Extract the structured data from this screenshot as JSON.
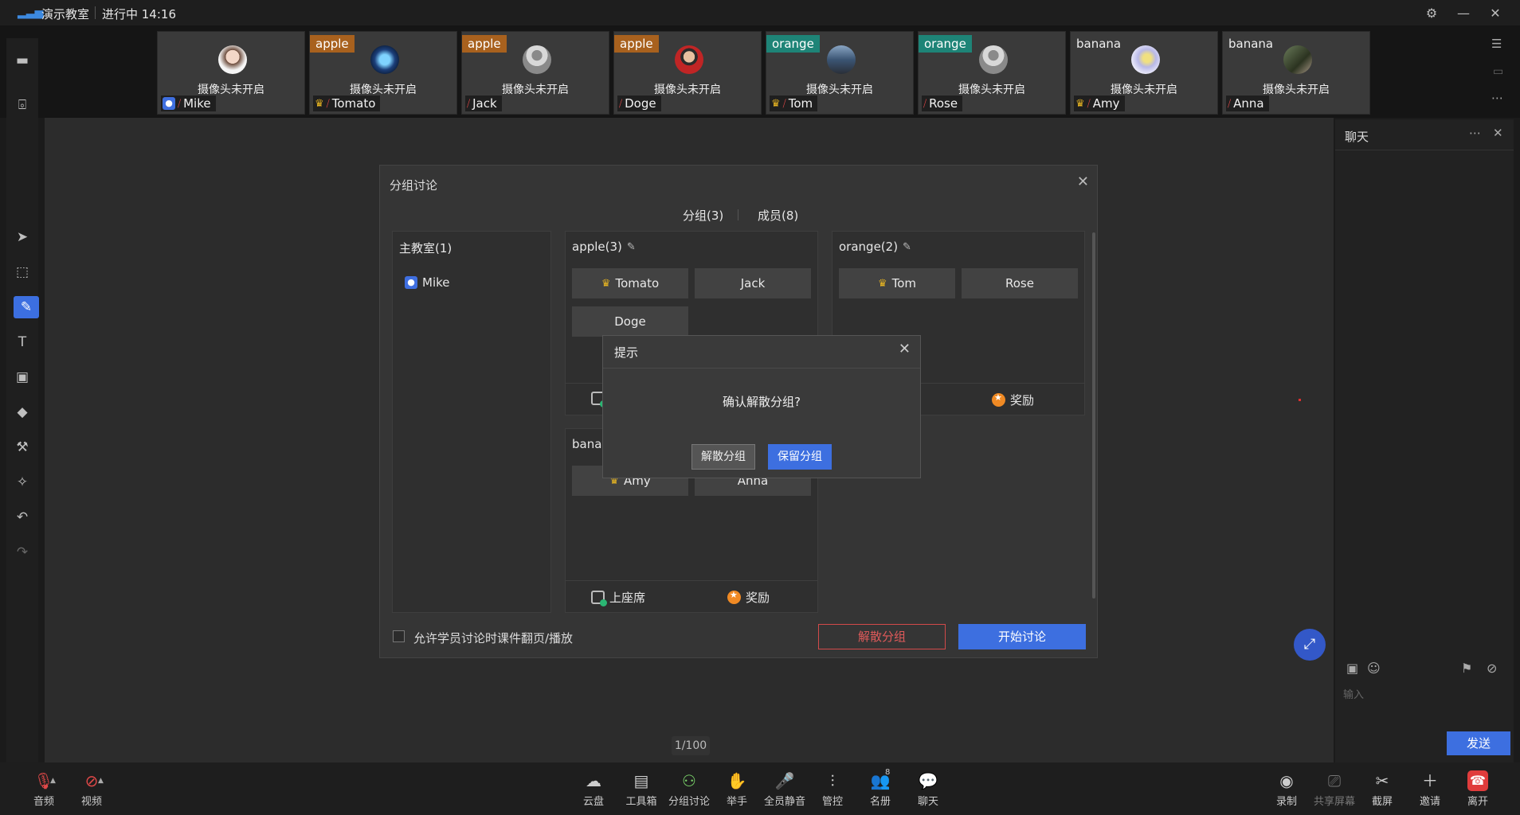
{
  "titlebar": {
    "room": "演示教室",
    "status": "进行中 14:16"
  },
  "tiles": [
    {
      "tag": "",
      "name": "Mike",
      "cam": "摄像头未开启",
      "crown": false,
      "host": true
    },
    {
      "tag": "apple",
      "name": "Tomato",
      "cam": "摄像头未开启",
      "crown": true
    },
    {
      "tag": "apple",
      "name": "Jack",
      "cam": "摄像头未开启",
      "crown": false
    },
    {
      "tag": "apple",
      "name": "Doge",
      "cam": "摄像头未开启",
      "crown": false
    },
    {
      "tag": "orange",
      "name": "Tom",
      "cam": "摄像头未开启",
      "crown": true
    },
    {
      "tag": "orange",
      "name": "Rose",
      "cam": "摄像头未开启",
      "crown": false
    },
    {
      "tag": "banana",
      "name": "Amy",
      "cam": "摄像头未开启",
      "crown": true
    },
    {
      "tag": "banana",
      "name": "Anna",
      "cam": "摄像头未开启",
      "crown": false
    }
  ],
  "dialog": {
    "title": "分组讨论",
    "tab_groups": "分组(3)",
    "tab_members": "成员(8)",
    "main_room": {
      "title": "主教室(1)",
      "member": "Mike"
    },
    "apple": {
      "title": "apple(3)",
      "m1": "Tomato",
      "m2": "Jack",
      "m3": "Doge"
    },
    "orange": {
      "title": "orange(2)",
      "m1": "Tom",
      "m2": "Rose",
      "reward": "奖励"
    },
    "banana": {
      "title": "banar",
      "m1": "Amy",
      "m2": "Anna",
      "seat": "上座席",
      "reward": "奖励"
    },
    "allow_label": "允许学员讨论时课件翻页/播放",
    "disband": "解散分组",
    "start": "开始讨论"
  },
  "confirm": {
    "title": "提示",
    "message": "确认解散分组?",
    "disband": "解散分组",
    "keep": "保留分组"
  },
  "chat": {
    "title": "聊天",
    "placeholder": "输入",
    "send": "发送"
  },
  "page": "1/100",
  "bottom": {
    "audio": "音频",
    "video": "视频",
    "cloud": "云盘",
    "toolbox": "工具箱",
    "breakout": "分组讨论",
    "raise": "举手",
    "muteall": "全员静音",
    "control": "管控",
    "roster": "名册",
    "chat": "聊天",
    "record": "录制",
    "share": "共享屏幕",
    "screenshot": "截屏",
    "invite": "邀请",
    "leave": "离开",
    "roster_count": "8"
  },
  "colors": {
    "accent": "#3d6fe0",
    "danger": "#e05a5a",
    "apple": "#a8611e",
    "orange": "#1e8477"
  }
}
